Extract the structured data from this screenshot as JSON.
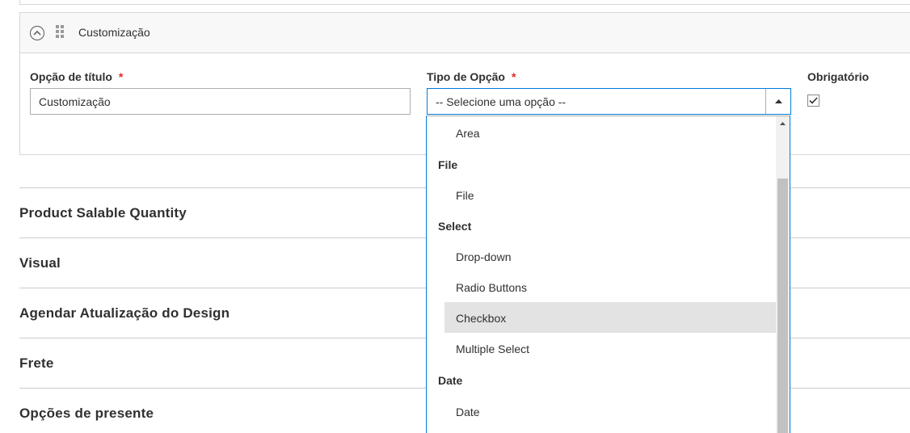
{
  "option": {
    "header_title": "Customização",
    "title_field": {
      "label": "Opção de título",
      "required_mark": "*",
      "value": "Customização"
    },
    "type_field": {
      "label": "Tipo de Opção",
      "required_mark": "*",
      "selected": "-- Selecione uma opção --"
    },
    "required_field": {
      "label": "Obrigatório",
      "checked": true
    }
  },
  "dropdown": {
    "entries": [
      {
        "kind": "item",
        "label": "Area"
      },
      {
        "kind": "group",
        "label": "File"
      },
      {
        "kind": "item",
        "label": "File"
      },
      {
        "kind": "group",
        "label": "Select"
      },
      {
        "kind": "item",
        "label": "Drop-down"
      },
      {
        "kind": "item",
        "label": "Radio Buttons"
      },
      {
        "kind": "item",
        "label": "Checkbox",
        "highlighted": true
      },
      {
        "kind": "item",
        "label": "Multiple Select"
      },
      {
        "kind": "group",
        "label": "Date"
      },
      {
        "kind": "item",
        "label": "Date"
      }
    ]
  },
  "sections": [
    "Product Salable Quantity",
    "Visual",
    "Agendar Atualização do Design",
    "Frete",
    "Opções de presente"
  ],
  "colors": {
    "accent": "#007bdb",
    "required": "#e22626",
    "highlight": "#e3e3e3"
  }
}
